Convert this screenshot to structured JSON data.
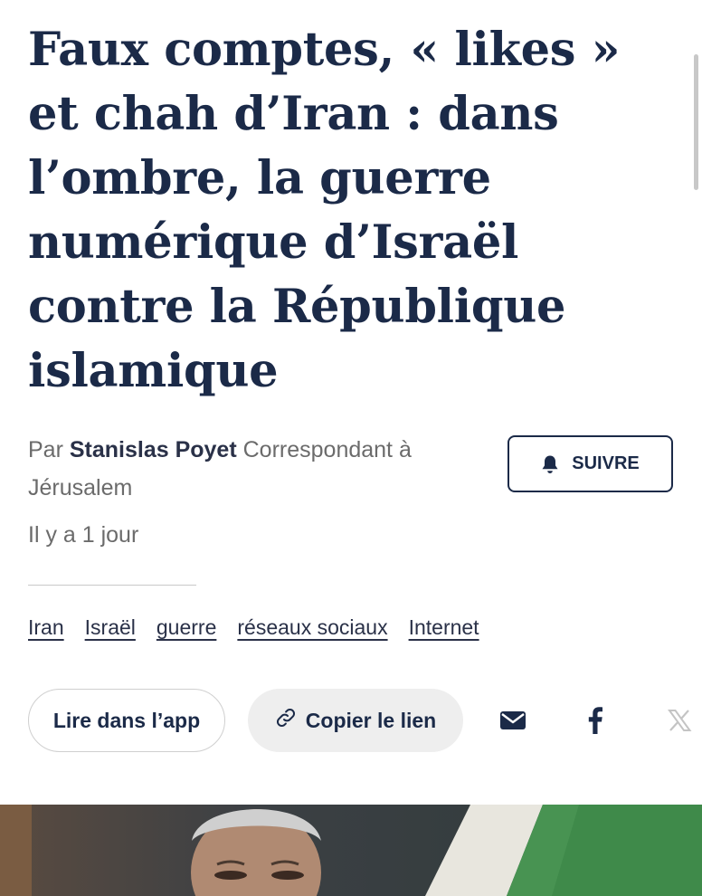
{
  "article": {
    "headline": "Faux comptes, « likes » et chah d’Iran : dans l’ombre, la guerre numérique d’Israël contre la République islamique",
    "byline_prefix": "Par ",
    "author": "Stanislas Poyet",
    "author_role": " Correspondant à Jérusalem",
    "follow_label": "SUIVRE",
    "date": "Il y a 1 jour"
  },
  "tags": [
    "Iran",
    "Israël",
    "guerre",
    "réseaux sociaux",
    "Internet"
  ],
  "actions": {
    "read_in_app": "Lire dans l’app",
    "copy_link": "Copier le lien",
    "share_icons": [
      "mail-icon",
      "facebook-icon",
      "x-icon"
    ]
  },
  "colors": {
    "primary_text": "#1b2a48",
    "secondary_text": "#6b6b6b",
    "copy_pill_bg": "#eeeeee"
  }
}
